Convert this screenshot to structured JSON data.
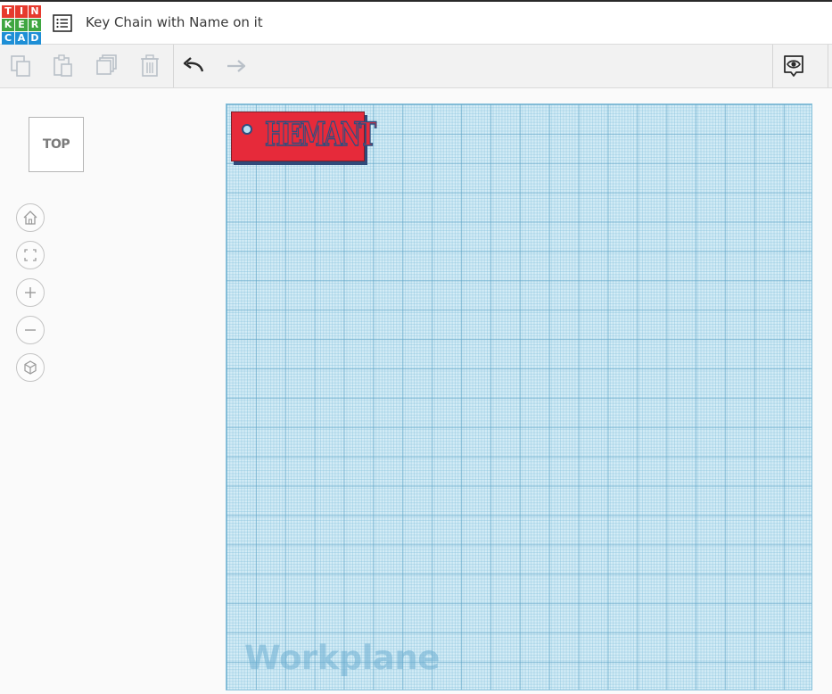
{
  "app": {
    "logo_letters": [
      "T",
      "I",
      "N",
      "K",
      "E",
      "R",
      "C",
      "A",
      "D"
    ],
    "logo_colors": [
      "#e63a2e",
      "#e63a2e",
      "#e63a2e",
      "#3fa641",
      "#3fa641",
      "#3fa641",
      "#1e8fd6",
      "#1e8fd6",
      "#1e8fd6"
    ],
    "design_title": "Key Chain with Name on it"
  },
  "toolbar": {
    "copy_icon": "copy-icon",
    "paste_icon": "paste-icon",
    "duplicate_icon": "duplicate-icon",
    "delete_icon": "trash-icon",
    "undo_icon": "undo-icon",
    "redo_icon": "redo-icon",
    "notes_icon": "notes-eye-icon"
  },
  "view": {
    "viewcube_label": "TOP",
    "nav_buttons": [
      "home-view-icon",
      "fit-all-icon",
      "zoom-in-icon",
      "zoom-out-icon",
      "ortho-perspective-icon"
    ]
  },
  "workplane": {
    "label": "Workplane",
    "object": {
      "text": "HEMANT",
      "body_color": "#e62a3a",
      "outline_color": "#2c4f80"
    }
  },
  "colors": {
    "accent": "#1e8fd6",
    "workplane_bg": "#d4ecf6",
    "icon_disabled": "#b9c0c8",
    "icon_active": "#2b2b2b"
  }
}
